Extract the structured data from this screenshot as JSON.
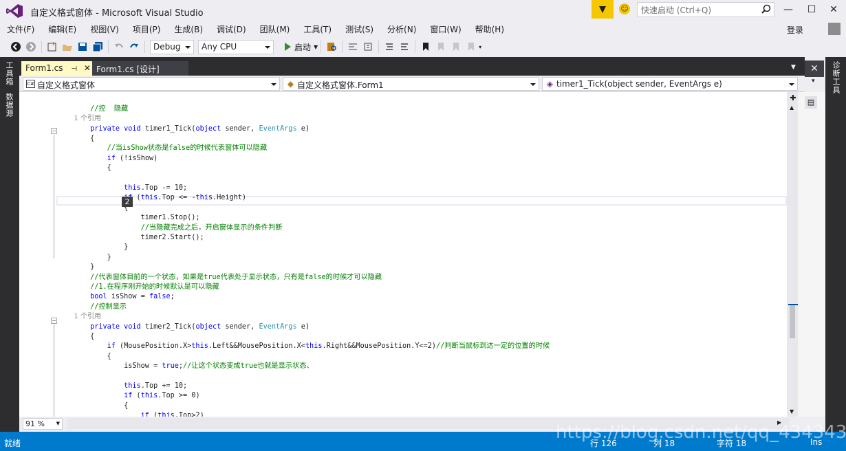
{
  "window": {
    "title": "自定义格式窗体 - Microsoft Visual Studio",
    "quick_launch_placeholder": "快速启动 (Ctrl+Q)",
    "sign_in": "登录"
  },
  "menu": [
    "文件(F)",
    "编辑(E)",
    "视图(V)",
    "项目(P)",
    "生成(B)",
    "调试(D)",
    "团队(M)",
    "工具(T)",
    "测试(S)",
    "分析(N)",
    "窗口(W)",
    "帮助(H)"
  ],
  "toolbar": {
    "config": "Debug",
    "platform": "Any CPU",
    "start_label": "启动"
  },
  "left_strip": [
    "工具箱",
    "数据源"
  ],
  "right_strip": [
    "诊断工具"
  ],
  "tabs": [
    {
      "label": "Form1.cs",
      "active": true
    },
    {
      "label": "Form1.cs [设计]",
      "active": false
    }
  ],
  "navbar": {
    "project": "自定义格式窗体",
    "class": "自定义格式窗体.Form1",
    "member": "timer1_Tick(object sender, EventArgs e)"
  },
  "code_lines": [
    [
      [
        "        }",
        "t"
      ]
    ],
    [
      [
        "",
        "t"
      ]
    ],
    [
      [
        "        //控",
        "cm"
      ],
      [
        "  ",
        "t"
      ],
      [
        "隐藏",
        "cm"
      ]
    ],
    [
      [
        "        1 个引用",
        "ref"
      ]
    ],
    [
      [
        "        ",
        "t"
      ],
      [
        "private",
        "kw"
      ],
      [
        " ",
        "t"
      ],
      [
        "void",
        "kw"
      ],
      [
        " timer1_Tick(",
        "t"
      ],
      [
        "object",
        "kw"
      ],
      [
        " sender, ",
        "t"
      ],
      [
        "EventArgs",
        "ty"
      ],
      [
        " e)",
        "t"
      ]
    ],
    [
      [
        "        {",
        "t"
      ]
    ],
    [
      [
        "            //当isShow状态是false的时候代表窗体可以隐藏",
        "cm"
      ]
    ],
    [
      [
        "            ",
        "t"
      ],
      [
        "if",
        "kw"
      ],
      [
        " (!isShow)",
        "t"
      ]
    ],
    [
      [
        "            {",
        "t"
      ]
    ],
    [
      [
        "",
        "t"
      ]
    ],
    [
      [
        "                ",
        "t"
      ],
      [
        "this",
        "kw"
      ],
      [
        ".Top -= 10;",
        "t"
      ]
    ],
    [
      [
        "                ",
        "t"
      ],
      [
        "if",
        "kw"
      ],
      [
        " (",
        "t"
      ],
      [
        "this",
        "kw"
      ],
      [
        ".Top <= -",
        "t"
      ],
      [
        "this",
        "kw"
      ],
      [
        ".Height)",
        "t"
      ]
    ],
    [
      [
        "                {",
        "t"
      ]
    ],
    [
      [
        "                    timer1.Stop();",
        "t"
      ]
    ],
    [
      [
        "                    //当隐藏完成之后，开启窗体显示的条件判断",
        "cm"
      ]
    ],
    [
      [
        "                    timer2.Start();",
        "t"
      ]
    ],
    [
      [
        "                }",
        "t"
      ]
    ],
    [
      [
        "            }",
        "t"
      ]
    ],
    [
      [
        "        }",
        "t"
      ]
    ],
    [
      [
        "        //代表窗体目前的一个状态，如果是true代表处于显示状态，只有是false的时候才可以隐藏",
        "cm"
      ]
    ],
    [
      [
        "        //1.在程序刚开始的时候默认是可以隐藏",
        "cm"
      ]
    ],
    [
      [
        "        ",
        "t"
      ],
      [
        "bool",
        "kw"
      ],
      [
        " isShow = ",
        "t"
      ],
      [
        "false",
        "kw"
      ],
      [
        ";",
        "t"
      ]
    ],
    [
      [
        "        //控制显示",
        "cm"
      ]
    ],
    [
      [
        "        1 个引用",
        "ref"
      ]
    ],
    [
      [
        "        ",
        "t"
      ],
      [
        "private",
        "kw"
      ],
      [
        " ",
        "t"
      ],
      [
        "void",
        "kw"
      ],
      [
        " timer2_Tick(",
        "t"
      ],
      [
        "object",
        "kw"
      ],
      [
        " sender, ",
        "t"
      ],
      [
        "EventArgs",
        "ty"
      ],
      [
        " e)",
        "t"
      ]
    ],
    [
      [
        "        {",
        "t"
      ]
    ],
    [
      [
        "            ",
        "t"
      ],
      [
        "if",
        "kw"
      ],
      [
        " (MousePosition.X>",
        "t"
      ],
      [
        "this",
        "kw"
      ],
      [
        ".Left&&MousePosition.X<",
        "t"
      ],
      [
        "this",
        "kw"
      ],
      [
        ".Right&&MousePosition.Y<=2)",
        "t"
      ],
      [
        "//判断当鼠标到达一定的位置的时候",
        "cm"
      ]
    ],
    [
      [
        "            {",
        "t"
      ]
    ],
    [
      [
        "                isShow = ",
        "t"
      ],
      [
        "true",
        "kw"
      ],
      [
        ";",
        "t"
      ],
      [
        "//让这个状态变成true也就是显示状态、",
        "cm"
      ]
    ],
    [
      [
        "",
        "t"
      ]
    ],
    [
      [
        "                ",
        "t"
      ],
      [
        "this",
        "kw"
      ],
      [
        ".Top += 10;",
        "t"
      ]
    ],
    [
      [
        "                ",
        "t"
      ],
      [
        "if",
        "kw"
      ],
      [
        " (",
        "t"
      ],
      [
        "this",
        "kw"
      ],
      [
        ".Top >= 0)",
        "t"
      ]
    ],
    [
      [
        "                {",
        "t"
      ]
    ],
    [
      [
        "                    ",
        "t"
      ],
      [
        "if",
        "kw"
      ],
      [
        " (",
        "t"
      ],
      [
        "this",
        "kw"
      ],
      [
        ".Top>2)",
        "t"
      ]
    ],
    [
      [
        "                    {",
        "t"
      ]
    ]
  ],
  "tooltip_number": "2",
  "zoom": "91 %",
  "status": {
    "ready": "就绪",
    "line": "行 126",
    "col": "列 18",
    "char": "字符 18",
    "ins": "Ins"
  },
  "watermark": "https://blog.csdn.net/qq_43434300",
  "colors": {
    "accent": "#007acc",
    "keyword": "#0000ff",
    "type": "#2b91af",
    "comment": "#008000"
  }
}
